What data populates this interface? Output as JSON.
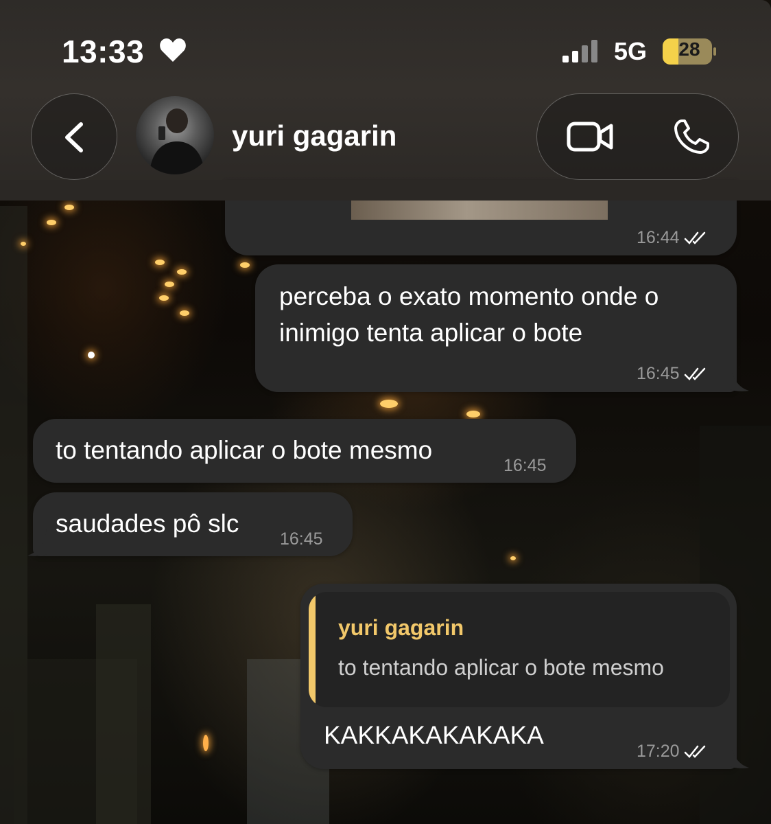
{
  "status_bar": {
    "time": "13:33",
    "network": "5G",
    "battery": "28"
  },
  "header": {
    "contact_name": "yuri gagarin"
  },
  "messages": [
    {
      "direction": "outgoing",
      "text": "",
      "time": "16:44"
    },
    {
      "direction": "outgoing",
      "text_lines": [
        "perceba o exato momento onde o",
        "inimigo tenta aplicar o bote"
      ],
      "time": "16:45"
    },
    {
      "direction": "incoming",
      "text": "to tentando aplicar o bote mesmo",
      "time": "16:45"
    },
    {
      "direction": "incoming",
      "text": "saudades pô slc",
      "time": "16:45"
    },
    {
      "direction": "outgoing",
      "reply_to": {
        "name": "yuri gagarin",
        "text": "to tentando aplicar o bote mesmo"
      },
      "text": "KAKKAKAKAKAKA",
      "time": "17:20"
    }
  ],
  "colors": {
    "bubble": "#2b2b2b",
    "accent": "#f2c86a",
    "timestamp": "#9a9a9a"
  },
  "icons": [
    "heart-icon",
    "signal-icon",
    "battery-charging-icon",
    "chevron-left-icon",
    "video-camera-icon",
    "phone-icon",
    "double-check-icon"
  ]
}
